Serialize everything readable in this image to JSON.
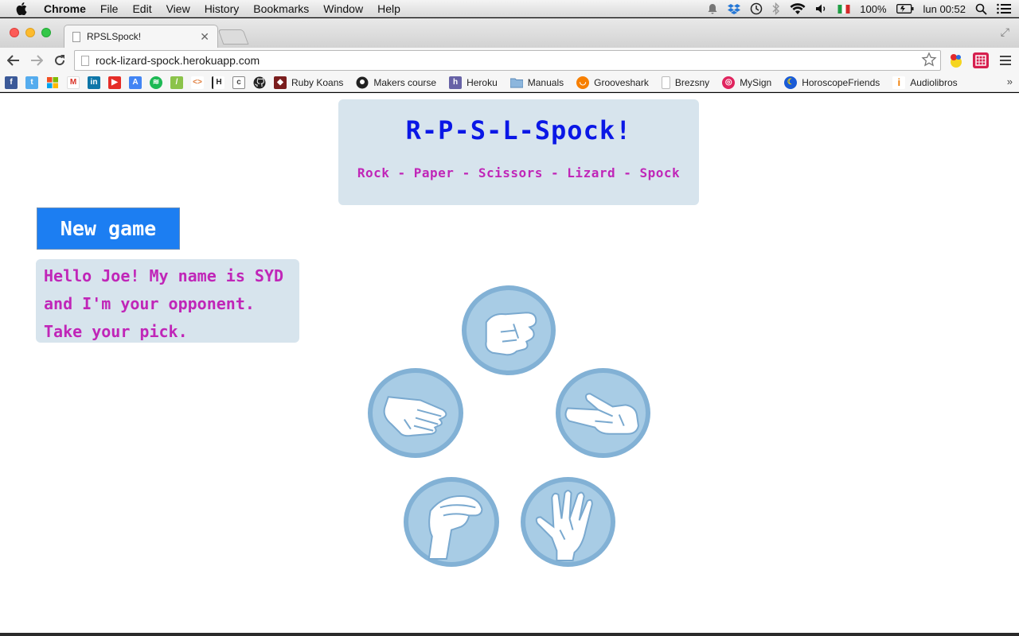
{
  "menubar": {
    "app_name": "Chrome",
    "items": [
      "File",
      "Edit",
      "View",
      "History",
      "Bookmarks",
      "Window",
      "Help"
    ],
    "battery": "100%",
    "clock": "lun 00:52"
  },
  "tab": {
    "title": "RPSLSpock!"
  },
  "toolbar": {
    "url": "rock-lizard-spock.herokuapp.com"
  },
  "bookmarks": {
    "labeled": [
      "Ruby Koans",
      "Makers course",
      "Heroku",
      "Manuals",
      "Grooveshark",
      "Brezsny",
      "MySign",
      "HoroscopeFriends",
      "Audiolibros"
    ],
    "more": "»"
  },
  "page": {
    "title": "R-P-S-L-Spock!",
    "subtitle": "Rock - Paper - Scissors - Lizard - Spock",
    "new_game_label": "New game",
    "message": "Hello Joe! My name is SYD and I'm your opponent. Take your pick."
  },
  "choices": [
    "rock",
    "paper",
    "scissors",
    "lizard",
    "spock"
  ],
  "colors": {
    "title": "#0a17e6",
    "accent_text": "#c026b8",
    "box_bg": "#d7e4ed",
    "button": "#1c7ef2",
    "circle_fill": "#a8cce5",
    "circle_border": "#82b1d5"
  }
}
